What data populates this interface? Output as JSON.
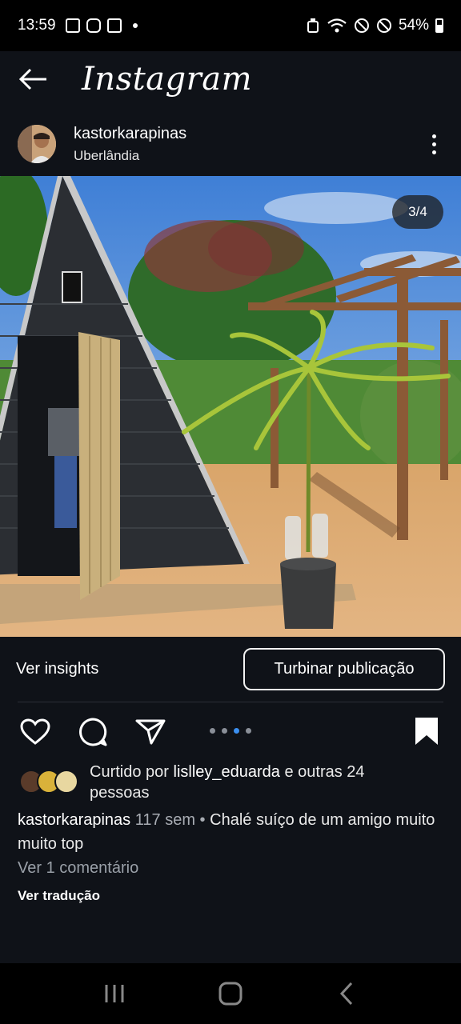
{
  "status_bar": {
    "time": "13:59",
    "battery": "54%"
  },
  "header": {
    "title": "Instagram"
  },
  "post": {
    "username": "kastorkarapinas",
    "location": "Uberlândia",
    "page_indicator": "3/4",
    "insights_label": "Ver insights",
    "boost_label": "Turbinar publicação",
    "likes_prefix": "Curtido por",
    "likes_user": "lislley_eduarda",
    "likes_suffix": "e outras 24 pessoas",
    "caption_user": "kastorkarapinas",
    "caption_time": "117 sem",
    "caption_text": "Chalé suíço de um amigo muito muito top",
    "view_comments": "Ver 1 comentário",
    "view_translation": "Ver tradução",
    "carousel": {
      "count": 4,
      "active_index": 2
    }
  },
  "colors": {
    "background": "#0f1218",
    "accent_dot": "#3b8ff0"
  },
  "icons": [
    "back-arrow-icon",
    "more-vert-icon",
    "heart-icon",
    "comment-icon",
    "share-icon",
    "bookmark-icon",
    "recents-icon",
    "home-icon",
    "back-nav-icon"
  ]
}
